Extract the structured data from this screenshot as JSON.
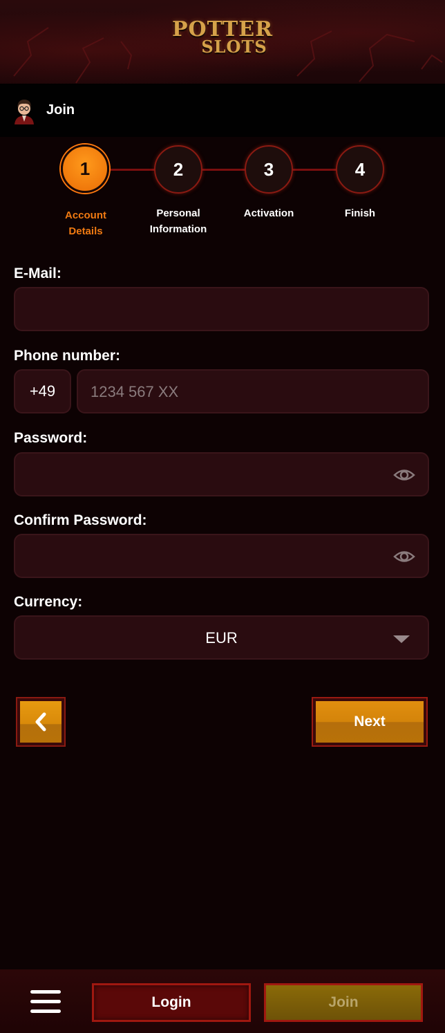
{
  "brand": {
    "line1": "POTTER",
    "line2": "SLOTS"
  },
  "subheader": {
    "title": "Join"
  },
  "steps": [
    {
      "number": "1",
      "label_line1": "Account",
      "label_line2": "Details"
    },
    {
      "number": "2",
      "label_line1": "Personal",
      "label_line2": "Information"
    },
    {
      "number": "3",
      "label_line1": "Activation",
      "label_line2": ""
    },
    {
      "number": "4",
      "label_line1": "Finish",
      "label_line2": ""
    }
  ],
  "form": {
    "email_label": "E-Mail:",
    "email_value": "",
    "phone_label": "Phone number:",
    "phone_prefix": "+49",
    "phone_placeholder": "1234 567 XX",
    "password_label": "Password:",
    "confirm_label": "Confirm Password:",
    "currency_label": "Currency:",
    "currency_value": "EUR"
  },
  "actions": {
    "next_label": "Next"
  },
  "bottom_nav": {
    "login_label": "Login",
    "join_label": "Join"
  },
  "colors": {
    "accent": "#ea6c05",
    "field_bg": "#2a0c10",
    "button_gold": "#d98a0a",
    "border_red": "#8a1a12"
  }
}
